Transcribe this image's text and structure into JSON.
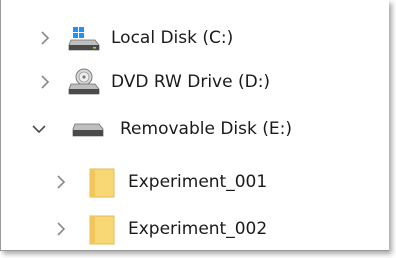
{
  "tree": {
    "items": [
      {
        "label": "Local Disk (C:)",
        "icon": "local-disk-icon",
        "expanded": false
      },
      {
        "label": "DVD RW Drive (D:)",
        "icon": "dvd-drive-icon",
        "expanded": false
      },
      {
        "label": "Removable Disk (E:)",
        "icon": "removable-disk-icon",
        "expanded": true
      },
      {
        "label": "Experiment_001",
        "icon": "folder-icon",
        "expanded": false
      },
      {
        "label": "Experiment_002",
        "icon": "folder-icon",
        "expanded": false
      }
    ]
  },
  "colors": {
    "chevron": "#8a8a8a",
    "chevron_expanded": "#4a4a4a",
    "folder": "#f8d775",
    "folder_tab": "#e5b94f",
    "text": "#1a1a1a"
  }
}
